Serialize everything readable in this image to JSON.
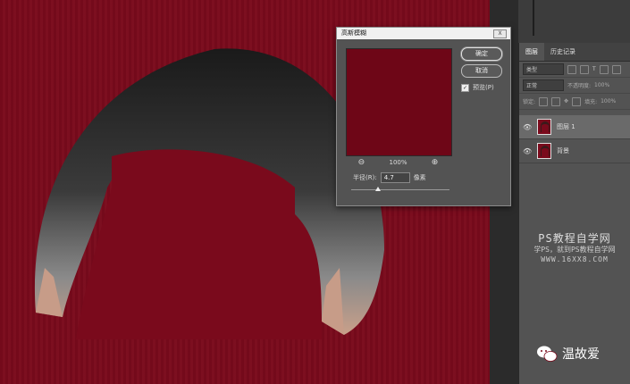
{
  "dialog": {
    "title": "高斯模糊",
    "close_label": "X",
    "ok_label": "确定",
    "cancel_label": "取消",
    "preview_label": "预览(P)",
    "preview_checked": true,
    "zoom_level": "100%",
    "radius_label": "半径(R):",
    "radius_value": "4.7",
    "radius_unit": "像素",
    "radius_slider_fraction": 0.27,
    "preview_color": "#6e0617"
  },
  "layers_panel": {
    "tabs": [
      "图层",
      "历史记录"
    ],
    "filter_placeholder": "类型",
    "blend_mode": "正常",
    "opacity_label": "不透明度:",
    "opacity_value": "100%",
    "lock_label": "锁定:",
    "fill_label": "填充:",
    "fill_value": "100%",
    "layers": [
      {
        "name": "图层 1",
        "active": true
      },
      {
        "name": "背景",
        "active": false
      }
    ]
  },
  "watermark": {
    "title": "PS教程自学网",
    "subtitle": "学PS，就到PS教程自学网",
    "url": "WWW.16XX8.COM"
  },
  "wechat": {
    "account": "温故爱"
  },
  "colors": {
    "canvas_red": "#7a0a1c",
    "panel_gray": "#535353"
  }
}
